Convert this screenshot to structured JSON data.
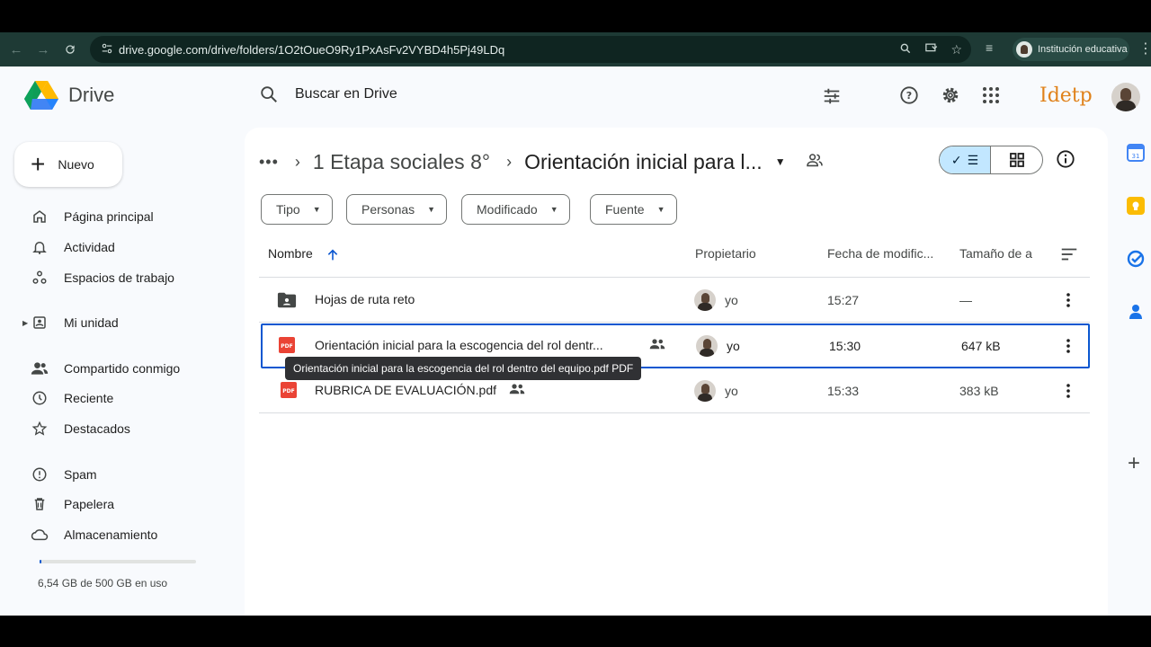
{
  "browser": {
    "url": "drive.google.com/drive/folders/1O2tOueO9Ry1PxAsFv2VYBD4h5Pj49LDq",
    "profile_label": "Institución educativa"
  },
  "app": {
    "name": "Drive",
    "brand_text": "Idetp"
  },
  "search": {
    "placeholder": "Buscar en Drive"
  },
  "sidebar": {
    "new_label": "Nuevo",
    "items": [
      {
        "label": "Página principal"
      },
      {
        "label": "Actividad"
      },
      {
        "label": "Espacios de trabajo"
      },
      {
        "label": "Mi unidad"
      },
      {
        "label": "Compartido conmigo"
      },
      {
        "label": "Reciente"
      },
      {
        "label": "Destacados"
      },
      {
        "label": "Spam"
      },
      {
        "label": "Papelera"
      },
      {
        "label": "Almacenamiento"
      }
    ],
    "storage_text": "6,54 GB de 500 GB en uso",
    "storage_used_fraction": 0.013
  },
  "breadcrumb": {
    "parent": "1 Etapa sociales 8°",
    "current": "Orientación inicial para l..."
  },
  "filters": [
    {
      "label": "Tipo"
    },
    {
      "label": "Personas"
    },
    {
      "label": "Modificado"
    },
    {
      "label": "Fuente"
    }
  ],
  "table": {
    "columns": {
      "name": "Nombre",
      "owner": "Propietario",
      "modified": "Fecha de modific...",
      "size": "Tamaño de a"
    },
    "rows": [
      {
        "name": "Hojas de ruta  reto",
        "type": "shared-folder",
        "shared": false,
        "owner": "yo",
        "modified": "15:27",
        "size": "—"
      },
      {
        "name": "Orientación inicial para la escogencia del rol dentr...",
        "type": "pdf",
        "shared": true,
        "owner": "yo",
        "modified": "15:30",
        "size": "647 kB"
      },
      {
        "name": "RUBRICA DE EVALUACIÓN.pdf",
        "type": "pdf",
        "shared": true,
        "owner": "yo",
        "modified": "15:33",
        "size": "383 kB"
      }
    ]
  },
  "tooltip": "Orientación inicial para la escogencia del rol dentro del equipo.pdf PDF",
  "colors": {
    "accent": "#0b57d0",
    "selected_toggle": "#c2e7ff",
    "pdf_red": "#ea4335",
    "brand": "#e0821b"
  }
}
